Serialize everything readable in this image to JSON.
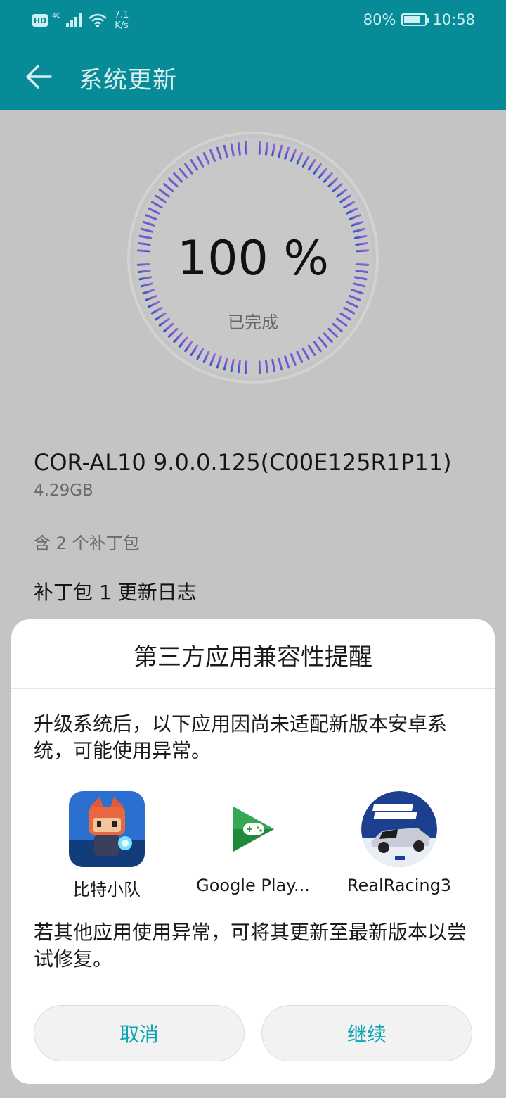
{
  "status_bar": {
    "hd": "HD",
    "network": "4G",
    "speed_value": "7.1",
    "speed_unit": "K/s",
    "battery": "80%",
    "battery_level": 0.8,
    "time": "10:58"
  },
  "app_bar": {
    "title": "系统更新",
    "back_icon": "arrow-left-icon"
  },
  "progress": {
    "percent_text": "100 %",
    "value": 1.0,
    "status": "已完成",
    "colors": {
      "start": "#3b4fc9",
      "end": "#9b6bd8",
      "track": "#d2d2d2"
    }
  },
  "update": {
    "version": "COR-AL10 9.0.0.125(C00E125R1P11)",
    "size": "4.29GB",
    "patch_count": "含 2 个补丁包",
    "patch_log": "补丁包 1 更新日志"
  },
  "dialog": {
    "title": "第三方应用兼容性提醒",
    "message": "升级系统后，以下应用因尚未适配新版本安卓系统，可能使用异常。",
    "apps": [
      {
        "label": "比特小队",
        "icon": "game-character-icon"
      },
      {
        "label": "Google Play...",
        "icon": "google-play-games-icon"
      },
      {
        "label": "RealRacing3",
        "icon": "real-racing-icon"
      }
    ],
    "hint": "若其他应用使用异常，可将其更新至最新版本以尝试修复。",
    "cancel_label": "取消",
    "continue_label": "继续",
    "accent": "#0fa6b4"
  }
}
